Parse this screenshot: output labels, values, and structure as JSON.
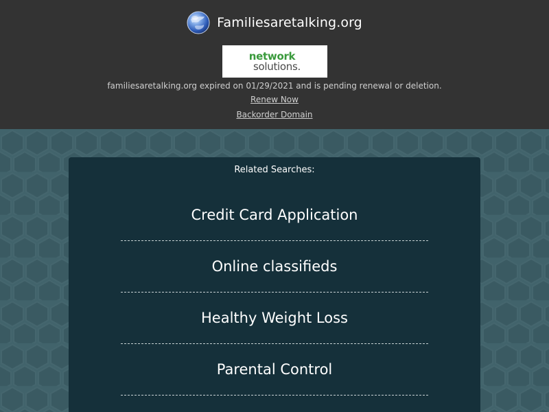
{
  "header": {
    "site_name": "Familiesaretalking.org",
    "globe_icon": "globe-icon"
  },
  "registrar": {
    "logo_line1": "network",
    "logo_line2": "solutions.",
    "logo_colors": {
      "green": "#3a9a3c",
      "gray": "#4a4a4a"
    }
  },
  "notice": {
    "expiry_text": "familiesaretalking.org expired on 01/29/2021 and is pending renewal or deletion.",
    "renew_label": "Renew Now",
    "backorder_label": "Backorder Domain"
  },
  "related": {
    "title": "Related Searches:",
    "items": [
      "Credit Card Application",
      "Online classifieds",
      "Healthy Weight Loss",
      "Parental Control"
    ]
  },
  "colors": {
    "top_bar": "#333333",
    "background": "#3f6068",
    "panel": "#15303a",
    "text": "#ffffff"
  }
}
